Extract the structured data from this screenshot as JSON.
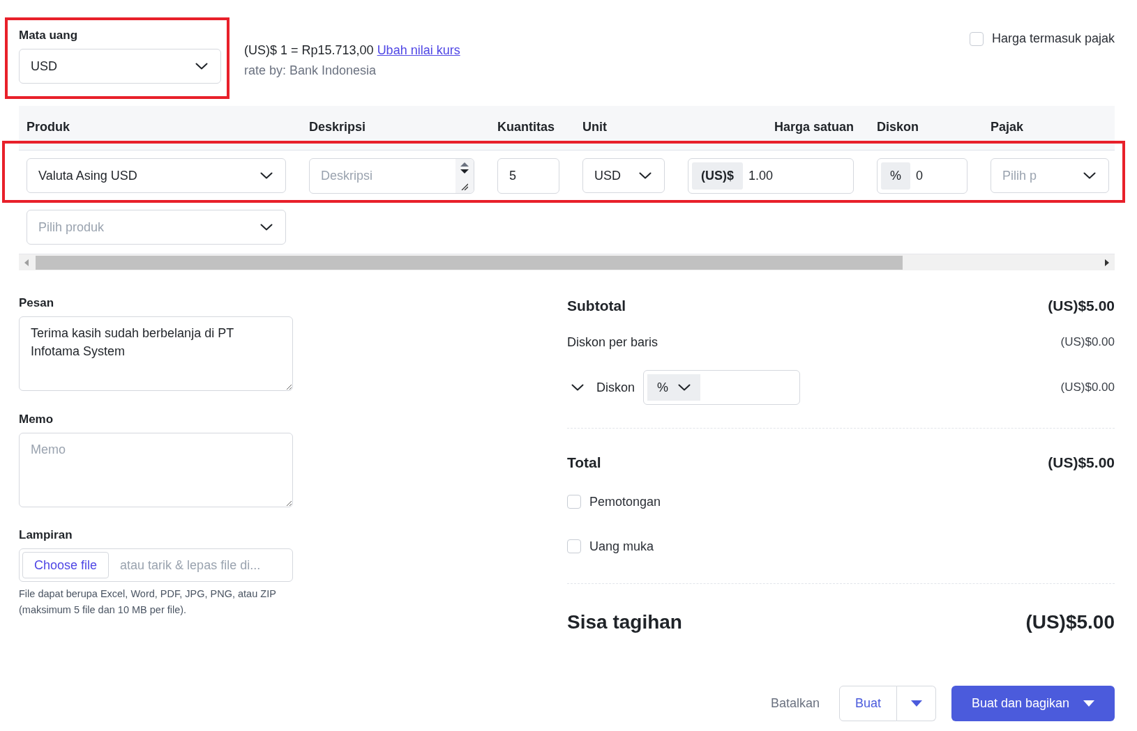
{
  "currency": {
    "label": "Mata uang",
    "value": "USD",
    "highlighted": true
  },
  "rate": {
    "text": "(US)$ 1 = Rp15.713,00",
    "link": "Ubah nilai kurs",
    "source": "rate by: Bank Indonesia"
  },
  "tax_inclusive": {
    "label": "Harga termasuk pajak",
    "checked": false
  },
  "table": {
    "columns": [
      "Produk",
      "Deskripsi",
      "Kuantitas",
      "Unit",
      "Harga satuan",
      "Diskon",
      "Pajak"
    ],
    "rows": [
      {
        "highlighted": true,
        "product": "Valuta Asing USD",
        "description_placeholder": "Deskripsi",
        "quantity": "5",
        "unit": "USD",
        "price_prefix": "(US)$",
        "price": "1.00",
        "discount_prefix": "%",
        "discount": "0",
        "tax_placeholder": "Pilih p"
      }
    ],
    "new_product_placeholder": "Pilih produk"
  },
  "message": {
    "label": "Pesan",
    "value": "Terima kasih sudah berbelanja di PT Infotama System"
  },
  "memo": {
    "label": "Memo",
    "placeholder": "Memo"
  },
  "attachment": {
    "label": "Lampiran",
    "button": "Choose file",
    "hint": "atau tarik & lepas file di...",
    "note": "File dapat berupa Excel, Word, PDF, JPG, PNG, atau ZIP (maksimum 5 file dan 10 MB per file)."
  },
  "summary": {
    "subtotal": {
      "label": "Subtotal",
      "value": "(US)$5.00"
    },
    "line_discount": {
      "label": "Diskon per baris",
      "value": "(US)$0.00"
    },
    "discount": {
      "label": "Diskon",
      "type": "%",
      "value": "(US)$0.00"
    },
    "total": {
      "label": "Total",
      "value": "(US)$5.00"
    },
    "options": [
      {
        "label": "Pemotongan",
        "checked": false
      },
      {
        "label": "Uang muka",
        "checked": false
      }
    ],
    "balance": {
      "label": "Sisa tagihan",
      "value": "(US)$5.00"
    }
  },
  "actions": {
    "cancel": "Batalkan",
    "create": "Buat",
    "create_share": "Buat dan bagikan"
  }
}
